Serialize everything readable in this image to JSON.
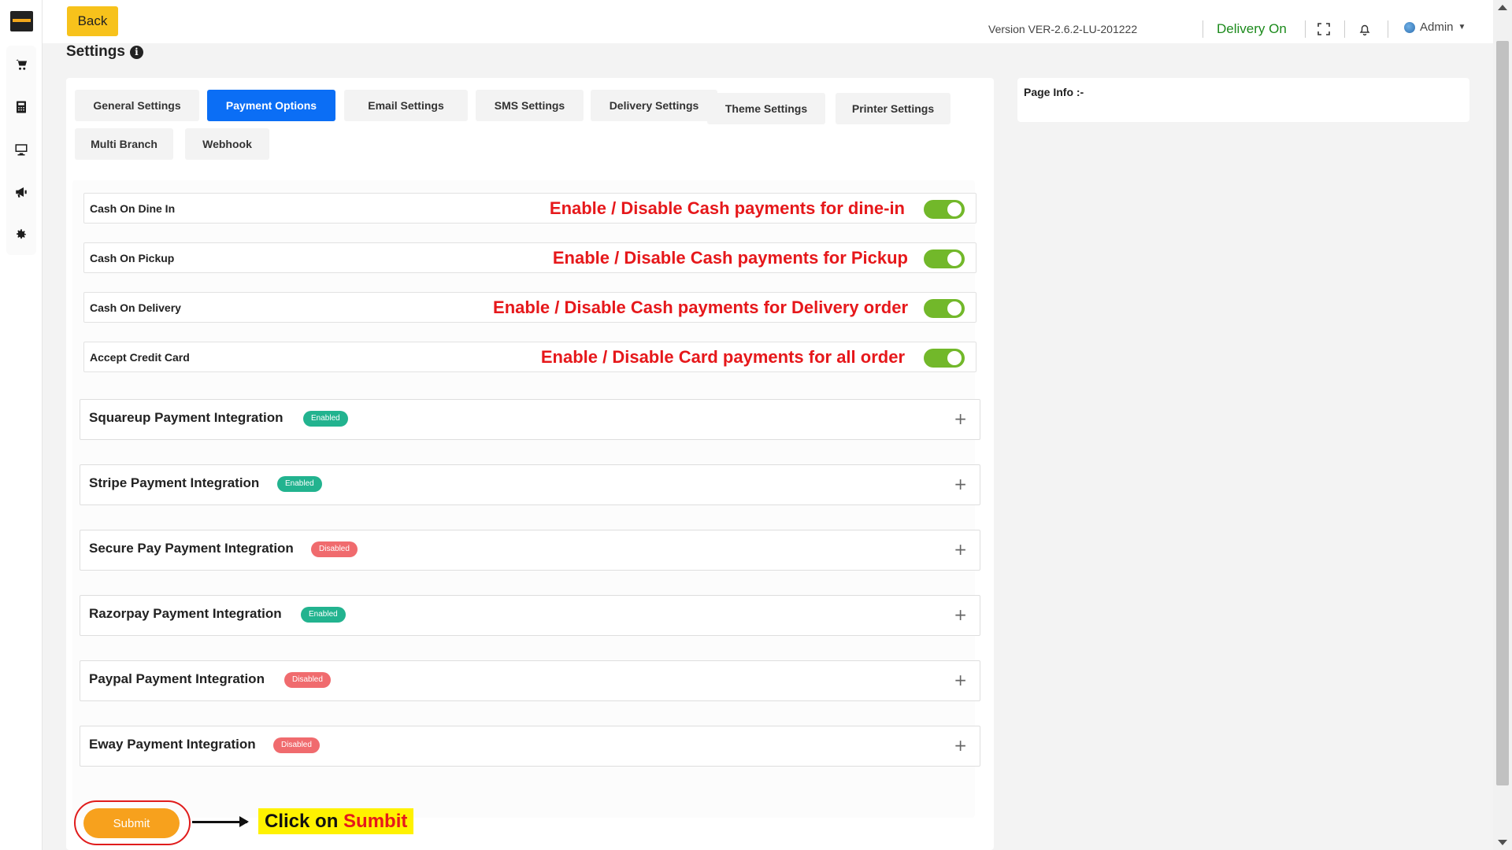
{
  "header": {
    "back_label": "Back",
    "version": "Version VER-2.6.2-LU-201222",
    "delivery_status": "Delivery On",
    "user_label": "Admin"
  },
  "page": {
    "title": "Settings"
  },
  "tabs": [
    {
      "label": "General Settings",
      "active": false
    },
    {
      "label": "Payment Options",
      "active": true
    },
    {
      "label": "Email Settings",
      "active": false
    },
    {
      "label": "SMS Settings",
      "active": false
    },
    {
      "label": "Delivery Settings",
      "active": false
    },
    {
      "label": "Theme Settings",
      "active": false
    },
    {
      "label": "Printer Settings",
      "active": false
    },
    {
      "label": "Multi Branch",
      "active": false
    },
    {
      "label": "Webhook",
      "active": false
    }
  ],
  "payment_options": [
    {
      "label": "Cash On Dine In",
      "note": "Enable / Disable Cash payments for dine-in",
      "enabled": true
    },
    {
      "label": "Cash On Pickup",
      "note": "Enable / Disable Cash payments for Pickup",
      "enabled": true
    },
    {
      "label": "Cash On Delivery",
      "note": "Enable / Disable Cash payments for Delivery order",
      "enabled": true
    },
    {
      "label": "Accept Credit Card",
      "note": "Enable / Disable Card payments for all order",
      "enabled": true
    }
  ],
  "integrations": [
    {
      "title": "Squareup Payment Integration",
      "status": "Enabled"
    },
    {
      "title": "Stripe Payment Integration",
      "status": "Enabled"
    },
    {
      "title": "Secure Pay Payment Integration",
      "status": "Disabled"
    },
    {
      "title": "Razorpay Payment Integration",
      "status": "Enabled"
    },
    {
      "title": "Paypal Payment Integration",
      "status": "Disabled"
    },
    {
      "title": "Eway Payment Integration",
      "status": "Disabled"
    }
  ],
  "submit": {
    "label": "Submit",
    "callout_part1": "Click on ",
    "callout_part2": "Sumbit"
  },
  "page_info": {
    "label": "Page Info :-"
  },
  "colors": {
    "accent_blue": "#0b6ef5",
    "back_yellow": "#f7c21b",
    "submit_orange": "#f7a11d",
    "toggle_green": "#72b82a",
    "badge_enabled": "#22b38f",
    "badge_disabled": "#f06b6e",
    "annotation_red": "#e6181b",
    "delivery_green": "#1b8a1b"
  },
  "icons": {
    "rail": [
      "cart-icon",
      "calculator-icon",
      "monitor-icon",
      "megaphone-icon",
      "gear-icon"
    ],
    "header": [
      "fullscreen-icon",
      "bell-icon",
      "globe-icon",
      "caret-down-icon"
    ],
    "title": "info-icon",
    "accordion": "plus-icon"
  }
}
